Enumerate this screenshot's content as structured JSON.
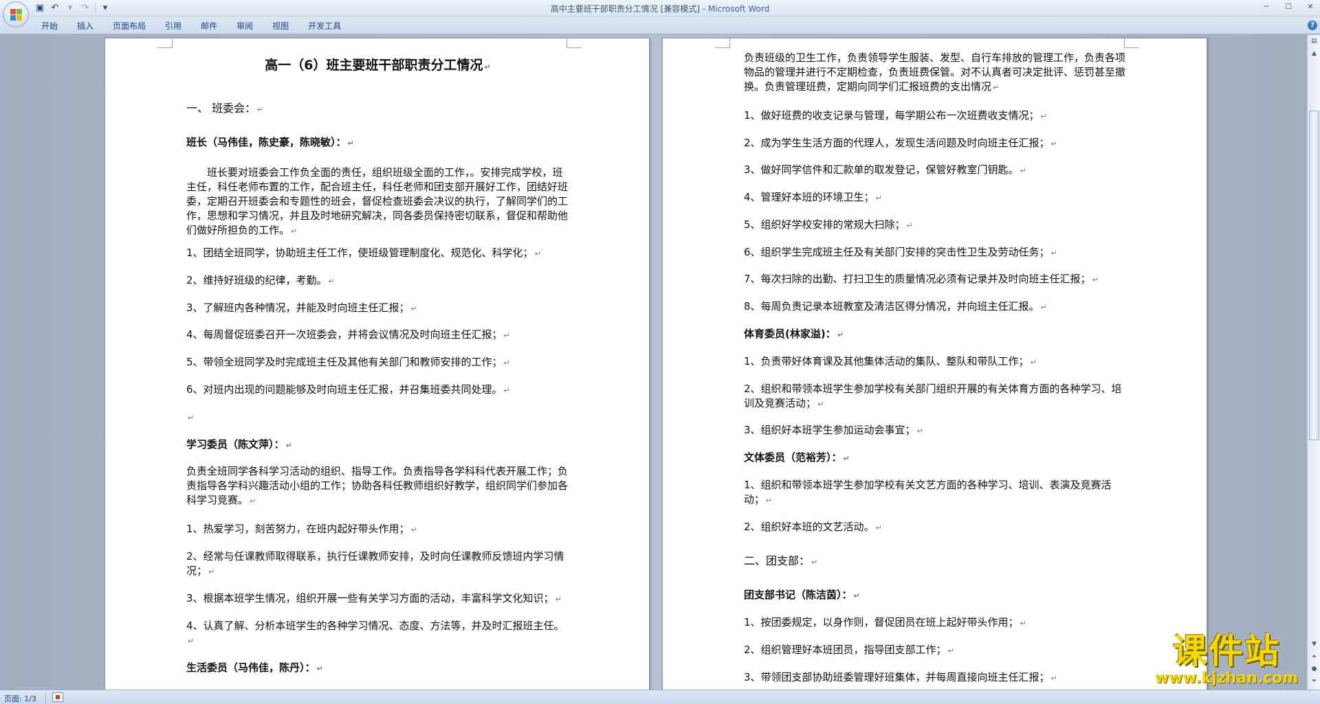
{
  "window": {
    "title": "高中主要班干部职责分工情况 [兼容模式] - ",
    "app": "Microsoft Word"
  },
  "qat": [
    "save-icon",
    "undo-icon",
    "redo-icon",
    "customize-icon"
  ],
  "ribbon": {
    "tabs": [
      "开始",
      "插入",
      "页面布局",
      "引用",
      "邮件",
      "审阅",
      "视图",
      "开发工具"
    ]
  },
  "pilcrow": "↵",
  "left_page": {
    "title": "高一（6）班主要班干部职责分工情况",
    "section1": "一、  班委会：",
    "monitor_heading": "班长（马伟佳，陈史豪，陈晓敏）：",
    "monitor_intro": "　　班长要对班委会工作负全面的责任，组织班级全面的工作，。安排完成学校，班主任，科任老师布置的工作，配合班主任，科任老师和团支部开展好工作，团结好班委，定期召开班委会和专题性的班会，督促检查班委会决议的执行，了解同学们的工作，思想和学习情况，并且及时地研究解决，同各委员保持密切联系，督促和帮助他们做好所担负的工作。",
    "monitor_items": [
      "1、团结全班同学，协助班主任工作，使班级管理制度化、规范化、科学化；",
      "2、维持好班级的纪律，考勤。",
      "3、了解班内各种情况，并能及时向班主任汇报；",
      "4、每周督促班委召开一次班委会，并将会议情况及时向班主任汇报；",
      "5、带领全班同学及时完成班主任及其他有关部门和教师安排的工作；",
      "6、对班内出现的问题能够及时向班主任汇报，并召集班委共同处理。"
    ],
    "study_heading": "学习委员（陈文萍）：",
    "study_intro": "负责全班同学各科学习活动的组织、指导工作。负责指导各学科科代表开展工作；负责指导各学科兴趣活动小组的工作；协助各科任教师组织好教学，组织同学们参加各科学习竞赛。",
    "study_items": [
      "1、热爱学习，刻苦努力，在班内起好带头作用；",
      "2、经常与任课教师取得联系，执行任课教师安排，及时向任课教师反馈班内学习情况；",
      "3、根据本班学生情况，组织开展一些有关学习方面的活动，丰富科学文化知识；",
      "4、认真了解、分析本班学生的各种学习情况、态度、方法等，并及时汇报班主任。"
    ],
    "life_heading": "生活委员（马伟佳，陈丹）："
  },
  "right_page": {
    "life_intro": "负责班级的卫生工作，负责领导学生服装、发型、自行车排放的管理工作，负责各项物品的管理并进行不定期检查，负责班费保管。对不认真者可决定批评、惩罚甚至撤换。负责管理班费，定期向同学们汇报班费的支出情况",
    "life_items": [
      "1、做好班费的收支记录与管理，每学期公布一次班费收支情况；",
      "2、成为学生生活方面的代理人，发现生活问题及时向班主任汇报；",
      "3、做好同学信件和汇款单的取发登记，保管好教室门钥匙。",
      "4、管理好本班的环境卫生；",
      "5、组织好学校安排的常规大扫除；",
      "6、组织学生完成班主任及有关部门安排的突击性卫生及劳动任务；",
      "7、每次扫除的出勤、打扫卫生的质量情况必须有记录并及时向班主任汇报；",
      "8、每周负责记录本班教室及清洁区得分情况，并向班主任汇报。"
    ],
    "sports_heading": "体育委员(林家溢)：",
    "sports_items": [
      "1、负责带好体育课及其他集体活动的集队、整队和带队工作；",
      "2、组织和带领本班学生参加学校有关部门组织开展的有关体育方面的各种学习、培训及竞赛活动；",
      "3、组织好本班学生参加运动会事宜；"
    ],
    "arts_heading": "文体委员（范裕芳）：",
    "arts_items": [
      "1、组织和带领本班学生参加学校有关文艺方面的各种学习、培训、表演及竞赛活动；",
      "2、组织好本班的文艺活动。"
    ],
    "section2": "二、团支部：",
    "league_heading": "团支部书记（陈洁茵）：",
    "league_items": [
      "1、按团委规定，以身作则，督促团员在班上起好带头作用；",
      "2、组织管理好本班团员，指导团支部工作；",
      "3、带领团支部协助班委管理好班集体，并每周直接向班主任汇报；"
    ]
  },
  "status": {
    "pages": "页面: 1/3"
  },
  "watermark": {
    "title": "课件站",
    "url": "www.kjzhan.com"
  }
}
